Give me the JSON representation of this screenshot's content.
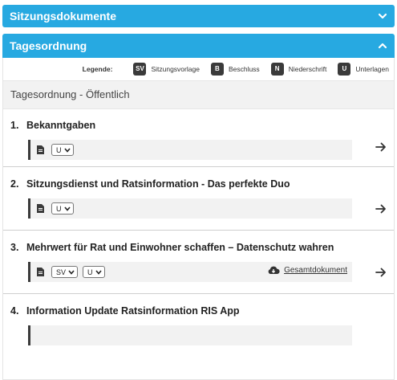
{
  "accordion": {
    "sitzungsdokumente_title": "Sitzungsdokumente",
    "tagesordnung_title": "Tagesordnung"
  },
  "legend": {
    "title": "Legende:",
    "items": [
      {
        "badge": "SV",
        "label": "Sitzungsvorlage"
      },
      {
        "badge": "B",
        "label": "Beschluss"
      },
      {
        "badge": "N",
        "label": "Niederschrift"
      },
      {
        "badge": "U",
        "label": "Unterlagen"
      }
    ]
  },
  "section": {
    "title": "Tagesordnung - Öffentlich"
  },
  "agenda": [
    {
      "num": "1.",
      "title": "Bekanntgaben",
      "selects": [
        "U"
      ]
    },
    {
      "num": "2.",
      "title": "Sitzungsdienst und Ratsinformation - Das perfekte Duo",
      "selects": [
        "U"
      ]
    },
    {
      "num": "3.",
      "title": "Mehrwert für Rat und Einwohner schaffen – Datenschutz wahren",
      "selects": [
        "SV",
        "U"
      ],
      "gesamt": "Gesamtdokument"
    },
    {
      "num": "4.",
      "title": "Information Update Ratsinformation RIS App"
    }
  ],
  "colors": {
    "accent": "#27a9e1",
    "badge": "#3a3a3a"
  },
  "icons": {
    "expand": "chevron-down-icon",
    "collapse": "chevron-up-icon",
    "document": "document-icon",
    "download": "cloud-download-icon",
    "go": "arrow-right-icon"
  }
}
